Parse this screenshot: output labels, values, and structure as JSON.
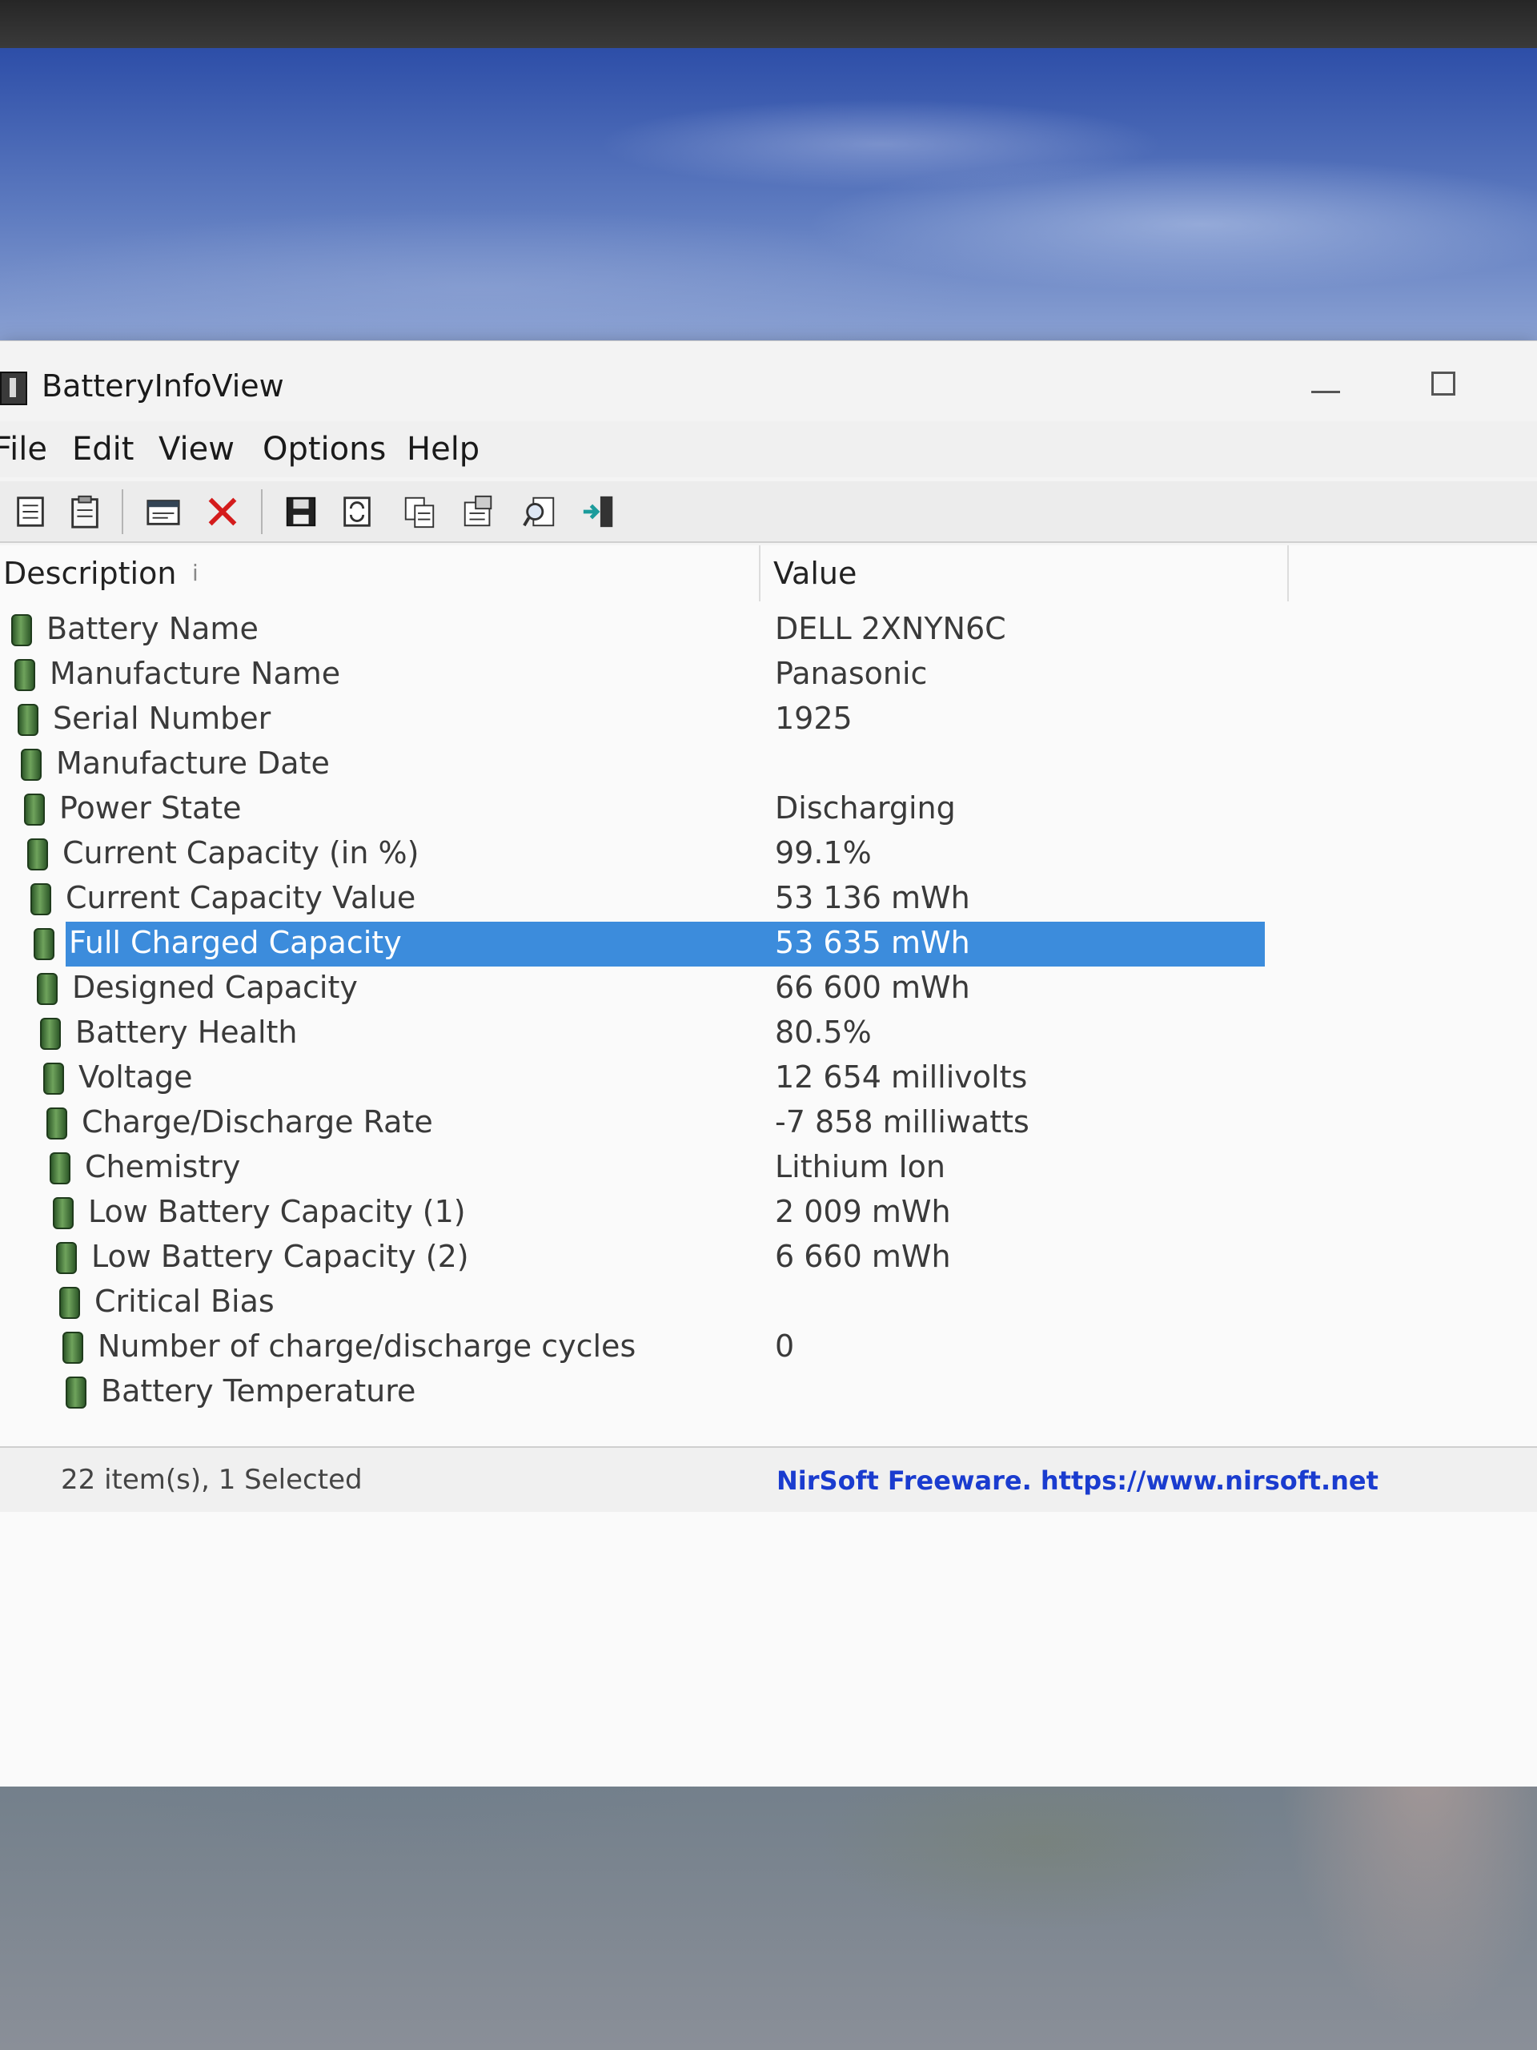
{
  "window": {
    "title": "BatteryInfoView",
    "icon": "battery-app-icon",
    "controls": [
      "minimize-icon",
      "maximize-icon"
    ]
  },
  "menu": [
    "File",
    "Edit",
    "View",
    "Options",
    "Help"
  ],
  "toolbar": {
    "icons": [
      "properties-icon",
      "clipboard-icon",
      "html-report-icon",
      "delete-icon",
      "save-icon",
      "refresh-icon",
      "copy-icon",
      "properties-dialog-icon",
      "find-icon",
      "exit-icon"
    ]
  },
  "columns": {
    "description": "Description",
    "value": "Value"
  },
  "rows": [
    {
      "description": "Battery Name",
      "value": "DELL 2XNYN6C"
    },
    {
      "description": "Manufacture Name",
      "value": "Panasonic"
    },
    {
      "description": "Serial Number",
      "value": "1925"
    },
    {
      "description": "Manufacture Date",
      "value": ""
    },
    {
      "description": "Power State",
      "value": "Discharging"
    },
    {
      "description": "Current Capacity (in %)",
      "value": "99.1%"
    },
    {
      "description": "Current Capacity Value",
      "value": "53 136 mWh"
    },
    {
      "description": "Full Charged Capacity",
      "value": "53 635 mWh",
      "selected": true
    },
    {
      "description": "Designed Capacity",
      "value": "66 600 mWh"
    },
    {
      "description": "Battery Health",
      "value": "80.5%"
    },
    {
      "description": "Voltage",
      "value": "12 654 millivolts"
    },
    {
      "description": "Charge/Discharge Rate",
      "value": "-7 858 milliwatts"
    },
    {
      "description": "Chemistry",
      "value": "Lithium Ion"
    },
    {
      "description": "Low Battery Capacity (1)",
      "value": "2 009 mWh"
    },
    {
      "description": "Low Battery Capacity (2)",
      "value": "6 660 mWh"
    },
    {
      "description": "Critical Bias",
      "value": ""
    },
    {
      "description": "Number of charge/discharge cycles",
      "value": "0"
    },
    {
      "description": "Battery Temperature",
      "value": ""
    }
  ],
  "status": {
    "items": "22 item(s), 1 Selected",
    "credit": "NirSoft Freeware. https://www.nirsoft.net"
  },
  "colors": {
    "selection": "#3c8cdc",
    "link": "#1a3ccf"
  }
}
